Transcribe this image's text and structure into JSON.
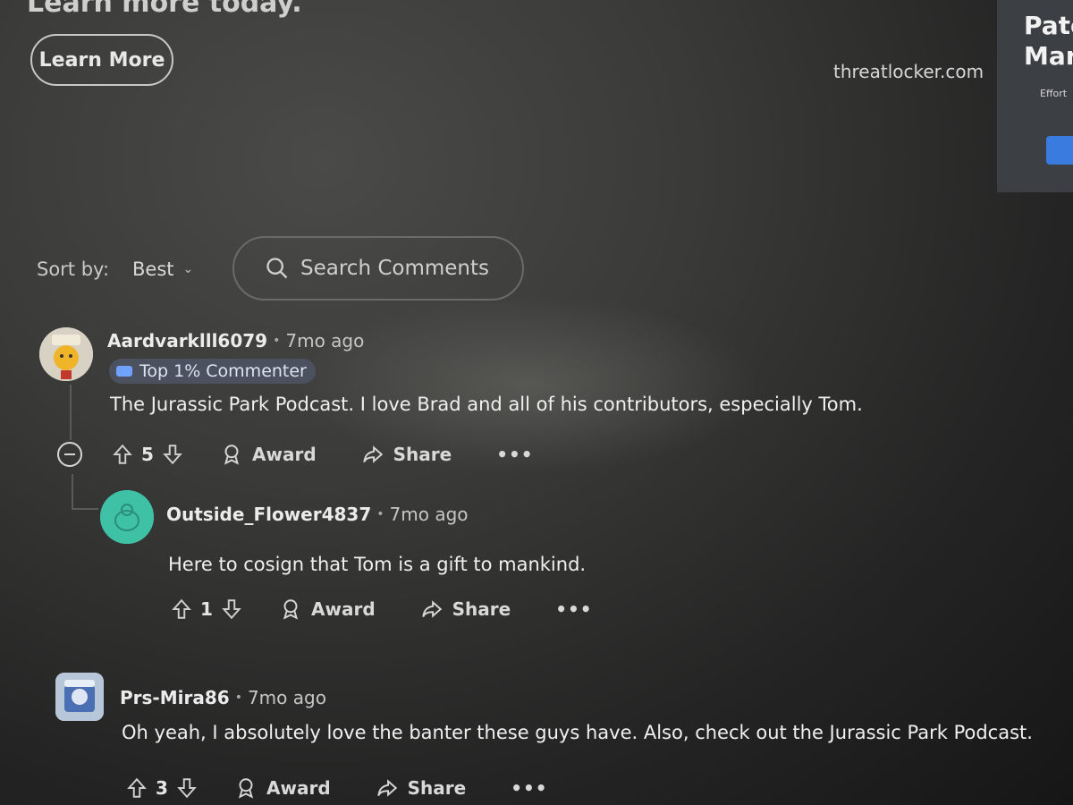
{
  "ad": {
    "headline_partial": "Learn more today.",
    "learn_more_label": "Learn More",
    "domain": "threatlocker.com",
    "side_ad": {
      "line1": "Pato",
      "line2": "Mar",
      "small": "Effort"
    }
  },
  "sort": {
    "label": "Sort by:",
    "value": "Best"
  },
  "search": {
    "placeholder": "Search Comments"
  },
  "comments": [
    {
      "user": "Aardvarklll6079",
      "time": "7mo ago",
      "flair": "Top 1% Commenter",
      "body": "The Jurassic Park Podcast. I love Brad and all of his contributors, especially Tom.",
      "votes": "5",
      "award_label": "Award",
      "share_label": "Share",
      "more_label": "•••"
    },
    {
      "user": "Outside_Flower4837",
      "time": "7mo ago",
      "body": "Here to cosign that Tom is a gift to mankind.",
      "votes": "1",
      "award_label": "Award",
      "share_label": "Share",
      "more_label": "•••"
    },
    {
      "user": "Prs-Mira86",
      "time": "7mo ago",
      "body": "Oh yeah, I absolutely love the banter these guys have. Also, check out the Jurassic Park Podcast.",
      "votes": "3",
      "award_label": "Award",
      "share_label": "Share",
      "more_label": "•••"
    }
  ],
  "separator": "•",
  "colors": {
    "background": "#2a2a2a",
    "text": "#f0f0f0",
    "side_ad_button": "#3a7be0",
    "avatar2": "#3fc1a6"
  }
}
